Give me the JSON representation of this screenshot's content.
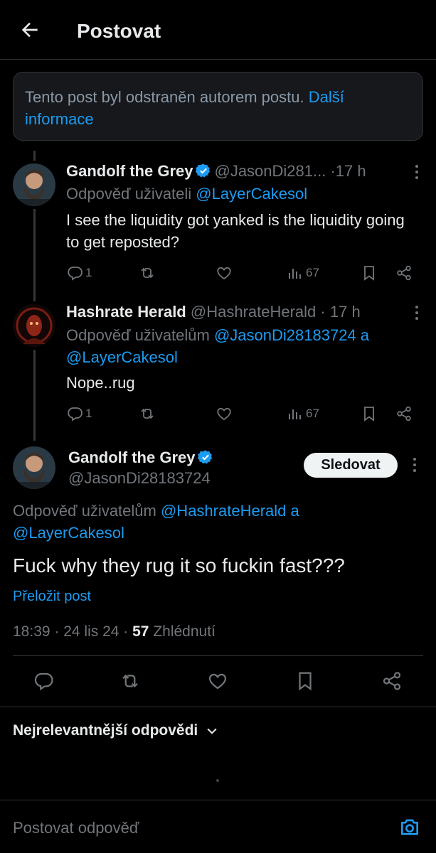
{
  "header": {
    "title": "Postovat",
    "back_icon": "arrow-left-icon"
  },
  "notice": {
    "text": "Tento post byl odstraněn autorem postu.",
    "link": "Další informace"
  },
  "replies": [
    {
      "name": "Gandolf the Grey",
      "verified": true,
      "handle": "@JasonDi281...",
      "dot": "·",
      "time": "17 h",
      "reply_prefix": "Odpověď uživateli ",
      "mentions": "@LayerCakesol",
      "text": "I see the liquidity got yanked is the liquidity going to get reposted?",
      "stats": {
        "replies": "1",
        "reposts": "",
        "likes": "",
        "views": "67"
      }
    },
    {
      "name": "Hashrate Herald",
      "verified": false,
      "handle": "@HashrateHerald",
      "dot": "·",
      "time": "17 h",
      "reply_prefix": "Odpověď uživatelům ",
      "mention_1": "@JasonDi28183724",
      "mention_join": " a ",
      "mention_2": "@LayerCakesol",
      "text": "Nope..rug",
      "stats": {
        "replies": "1",
        "reposts": "",
        "likes": "",
        "views": "67"
      }
    }
  ],
  "main_post": {
    "name": "Gandolf the Grey",
    "verified": true,
    "handle": "@JasonDi28183724",
    "follow_label": "Sledovat",
    "reply_prefix": "Odpověď uživatelům ",
    "mention_1": "@HashrateHerald",
    "mention_join": " a",
    "mention_2": "@LayerCakesol",
    "text": "Fuck why they rug it so fuckin fast???",
    "translate": "Přeložit post",
    "time": "18:39",
    "date": "24 lis 24",
    "views_count": "57",
    "views_label": "Zhlédnutí"
  },
  "sort": {
    "label": "Nejrelevantnější odpovědi"
  },
  "compose": {
    "placeholder": "Postovat odpověď"
  },
  "colors": {
    "background": "#000000",
    "accent": "#1d9bf0",
    "muted": "#71767b",
    "text": "#e7e9ea",
    "border": "#2f3336"
  }
}
